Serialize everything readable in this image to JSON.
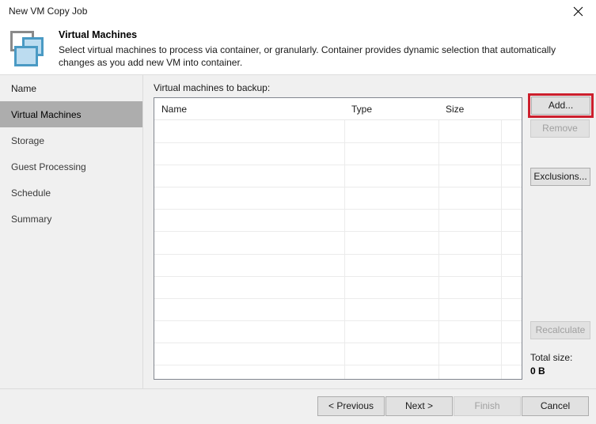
{
  "window": {
    "title": "New VM Copy Job",
    "close_icon": "close-icon"
  },
  "header": {
    "icon": "virtual-machines-icon",
    "title": "Virtual Machines",
    "description": "Select virtual machines to process via container, or granularly. Container provides dynamic selection that automatically changes as you add new VM into container."
  },
  "sidebar": {
    "items": [
      {
        "label": "Name",
        "selected": false
      },
      {
        "label": "Virtual Machines",
        "selected": true
      },
      {
        "label": "Storage",
        "selected": false
      },
      {
        "label": "Guest Processing",
        "selected": false
      },
      {
        "label": "Schedule",
        "selected": false
      },
      {
        "label": "Summary",
        "selected": false
      }
    ]
  },
  "main": {
    "list_label": "Virtual machines to backup:",
    "table": {
      "columns": [
        "Name",
        "Type",
        "Size"
      ],
      "rows": []
    },
    "buttons": {
      "add": "Add...",
      "remove": "Remove",
      "exclusions": "Exclusions...",
      "recalculate": "Recalculate"
    },
    "total_size_label": "Total size:",
    "total_size_value": "0 B",
    "highlight_color": "#cc1f2d"
  },
  "footer": {
    "previous": "< Previous",
    "next": "Next >",
    "finish": "Finish",
    "cancel": "Cancel"
  }
}
